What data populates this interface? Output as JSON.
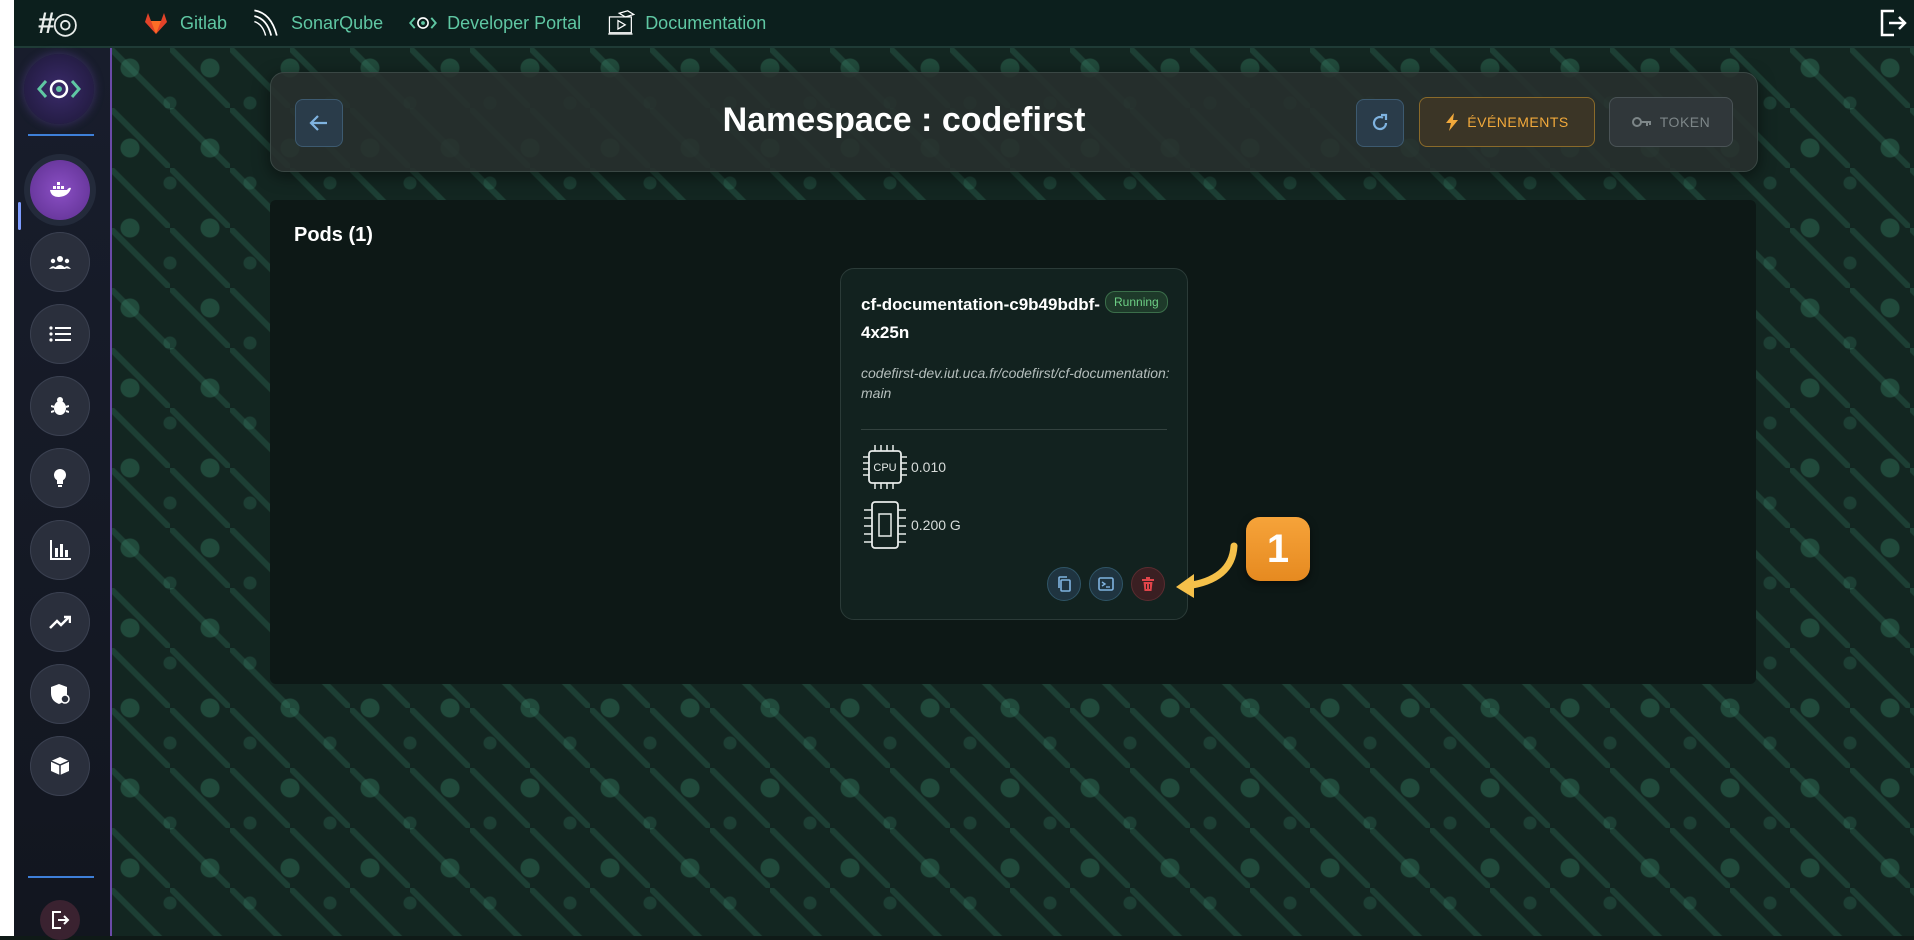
{
  "topbar": {
    "links": [
      {
        "label": "Gitlab",
        "icon": "gitlab-icon"
      },
      {
        "label": "SonarQube",
        "icon": "sonarqube-icon"
      },
      {
        "label": "Developer Portal",
        "icon": "developer-portal-icon"
      },
      {
        "label": "Documentation",
        "icon": "documentation-icon"
      }
    ]
  },
  "sidebar": {
    "items": [
      {
        "icon": "docker-icon",
        "active": true
      },
      {
        "icon": "users-icon"
      },
      {
        "icon": "list-icon"
      },
      {
        "icon": "bug-icon"
      },
      {
        "icon": "lightbulb-icon"
      },
      {
        "icon": "bar-chart-icon"
      },
      {
        "icon": "trending-icon"
      },
      {
        "icon": "shield-icon"
      },
      {
        "icon": "cube-icon"
      }
    ]
  },
  "header": {
    "title": "Namespace : codefirst",
    "events_label": "ÉVÉNEMENTS",
    "token_label": "TOKEN"
  },
  "pods": {
    "title": "Pods (1)",
    "items": [
      {
        "name": "cf-documentation-c9b49bdbf-4x25n",
        "status": "Running",
        "image": "codefirst-dev.iut.uca.fr/codefirst/cf-documentation:main",
        "cpu_label": "CPU",
        "cpu_value": "0.010",
        "memory_value": "0.200 G"
      }
    ]
  },
  "annotation": {
    "label": "1"
  },
  "colors": {
    "accent": "#5fc7a3",
    "events": "#f2a93b",
    "status_running": "#6dcf85",
    "delete": "#e0444a",
    "annotation": "#f29a2e"
  }
}
